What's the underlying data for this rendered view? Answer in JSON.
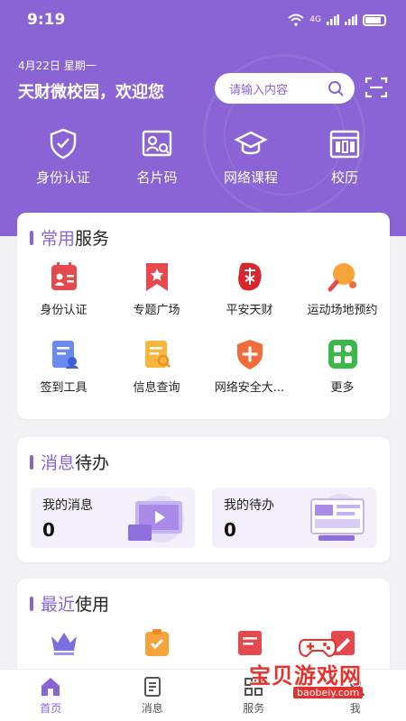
{
  "status_bar": {
    "time": "9:19",
    "network": "4G"
  },
  "header": {
    "date": "4月22日",
    "weekday": "星期一",
    "welcome": "天财微校园，欢迎您",
    "search_placeholder": "请输入内容",
    "bg_color": "#8a64d4"
  },
  "quick_actions": [
    {
      "label": "身份认证",
      "icon": "shield-check-icon"
    },
    {
      "label": "名片码",
      "icon": "id-card-icon"
    },
    {
      "label": "网络课程",
      "icon": "graduation-cap-icon"
    },
    {
      "label": "校历",
      "icon": "calendar-icon"
    }
  ],
  "services": {
    "title_accent": "常用",
    "title_rest": "服务",
    "items": [
      {
        "label": "身份认证",
        "icon": "id-badge-icon"
      },
      {
        "label": "专题广场",
        "icon": "bookmark-star-icon"
      },
      {
        "label": "平安天财",
        "icon": "seal-logo-icon"
      },
      {
        "label": "运动场地预约",
        "icon": "ping-pong-icon"
      },
      {
        "label": "签到工具",
        "icon": "checkin-doc-icon"
      },
      {
        "label": "信息查询",
        "icon": "doc-search-icon"
      },
      {
        "label": "网络安全大...",
        "icon": "shield-plus-icon"
      },
      {
        "label": "更多",
        "icon": "grid-more-icon"
      }
    ]
  },
  "messages": {
    "title_accent": "消息",
    "title_rest": "待办",
    "my_messages_label": "我的消息",
    "my_messages_count": "0",
    "my_todos_label": "我的待办",
    "my_todos_count": "0"
  },
  "recent": {
    "title_accent": "最近",
    "title_rest": "使用",
    "items": [
      {
        "label": "",
        "icon": "crown-icon"
      },
      {
        "label": "",
        "icon": "clipboard-check-icon"
      },
      {
        "label": "",
        "icon": "red-doc-icon"
      },
      {
        "label": "",
        "icon": "red-edit-icon"
      }
    ]
  },
  "tabbar": [
    {
      "label": "首页",
      "icon": "home-icon",
      "active": true
    },
    {
      "label": "消息",
      "icon": "message-doc-icon",
      "active": false
    },
    {
      "label": "服务",
      "icon": "service-grid-icon",
      "active": false
    },
    {
      "label": "我",
      "icon": "person-icon",
      "active": false
    }
  ],
  "watermark": {
    "text": "宝贝游戏网",
    "url": "baobeiy.com"
  }
}
